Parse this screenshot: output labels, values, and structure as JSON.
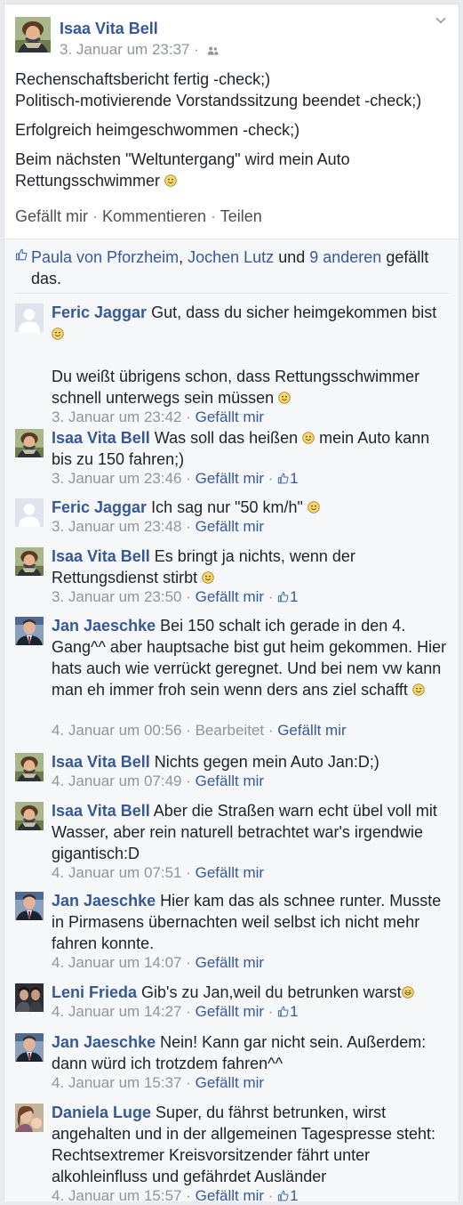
{
  "post": {
    "author": "Isaa Vita Bell",
    "timestamp": "3. Januar um 23:37",
    "dot": "·",
    "audience_icon": "friends-icon",
    "lines": [
      "Rechenschaftsbericht fertig -check;)",
      "Politisch-motivierende Vorstandssitzung beendet -check;)",
      "Erfolgreich heimgeschwommen -check;)",
      "Beim nächsten \"Weltuntergang\" wird mein Auto Rettungsschwimmer"
    ],
    "actions": {
      "like": "Gefällt mir",
      "comment": "Kommentieren",
      "share": "Teilen",
      "sep": " · "
    }
  },
  "likes": {
    "name1": "Paula von Pforzheim",
    "comma": ", ",
    "name2": "Jochen Lutz",
    "und": " und ",
    "others": "9 anderen",
    "suffix": " gefällt das."
  },
  "comments": [
    {
      "author": "Feric Jaggar",
      "text": "Gut, dass du sicher heimgekommen bist",
      "text2": "Du weißt übrigens schon, dass Rettungsschwimmer schnell unterwegs sein müssen",
      "time": "3. Januar um 23:42",
      "like": "Gefällt mir",
      "avatar": "default-avatar"
    },
    {
      "author": "Isaa Vita Bell",
      "text": "Was soll das heißen",
      "text_after": " mein Auto kann bis zu 150 fahren;)",
      "time": "3. Januar um 23:46",
      "like": "Gefällt mir",
      "likes": "1",
      "avatar": "isaa-avatar"
    },
    {
      "author": "Feric Jaggar",
      "text": "Ich sag nur \"50 km/h\"",
      "time": "3. Januar um 23:48",
      "like": "Gefällt mir",
      "avatar": "default-avatar"
    },
    {
      "author": "Isaa Vita Bell",
      "text": "Es bringt ja nichts, wenn der Rettungsdienst stirbt",
      "time": "3. Januar um 23:50",
      "like": "Gefällt mir",
      "likes": "1",
      "avatar": "isaa-avatar"
    },
    {
      "author": "Jan Jaeschke",
      "text": "Bei 150 schalt ich gerade in den 4. Gang^^ aber hauptsache bist gut heim gekommen. Hier hats auch wie verrückt geregnet. Und bei nem vw kann man eh immer froh sein wenn ders ans ziel schafft",
      "time": "4. Januar um 00:56",
      "edited": "Bearbeitet",
      "like": "Gefällt mir",
      "avatar": "jan-avatar"
    },
    {
      "author": "Isaa Vita Bell",
      "text": "Nichts gegen mein Auto Jan:D;)",
      "time": "4. Januar um 07:49",
      "like": "Gefällt mir",
      "avatar": "isaa-avatar"
    },
    {
      "author": "Isaa Vita Bell",
      "text": "Aber die Straßen warn echt übel voll mit Wasser, aber rein naturell betrachtet war's irgendwie gigantisch:D",
      "time": "4. Januar um 07:51",
      "like": "Gefällt mir",
      "avatar": "isaa-avatar"
    },
    {
      "author": "Jan Jaeschke",
      "text": "Hier kam das als schnee runter. Musste in Pirmasens übernachten weil selbst ich nicht mehr fahren konnte.",
      "time": "4. Januar um 14:07",
      "like": "Gefällt mir",
      "avatar": "jan-avatar"
    },
    {
      "author": "Leni Frieda",
      "text": "Gib's zu Jan,weil du betrunken warst",
      "time": "4. Januar um 14:27",
      "like": "Gefällt mir",
      "likes": "1",
      "avatar": "leni-avatar"
    },
    {
      "author": "Jan Jaeschke",
      "text": "Nein! Kann gar nicht sein. Außerdem: dann würd ich trotzdem fahren^^",
      "time": "4. Januar um 15:37",
      "like": "Gefällt mir",
      "avatar": "jan-avatar"
    },
    {
      "author": "Daniela Luge",
      "text": "Super, du fährst betrunken, wirst angehalten und in der allgemeinen Tagespresse steht: Rechtsextremer Kreisvorsitzender fährt unter alkohleinfluss und gefährdet Ausländer",
      "time": "4. Januar um 15:57",
      "like": "Gefällt mir",
      "likes": "1",
      "avatar": "daniela-avatar"
    }
  ],
  "colors": {
    "link": "#365899",
    "meta": "#90949c",
    "text": "#1d2129",
    "bg": "#f6f7f9"
  }
}
